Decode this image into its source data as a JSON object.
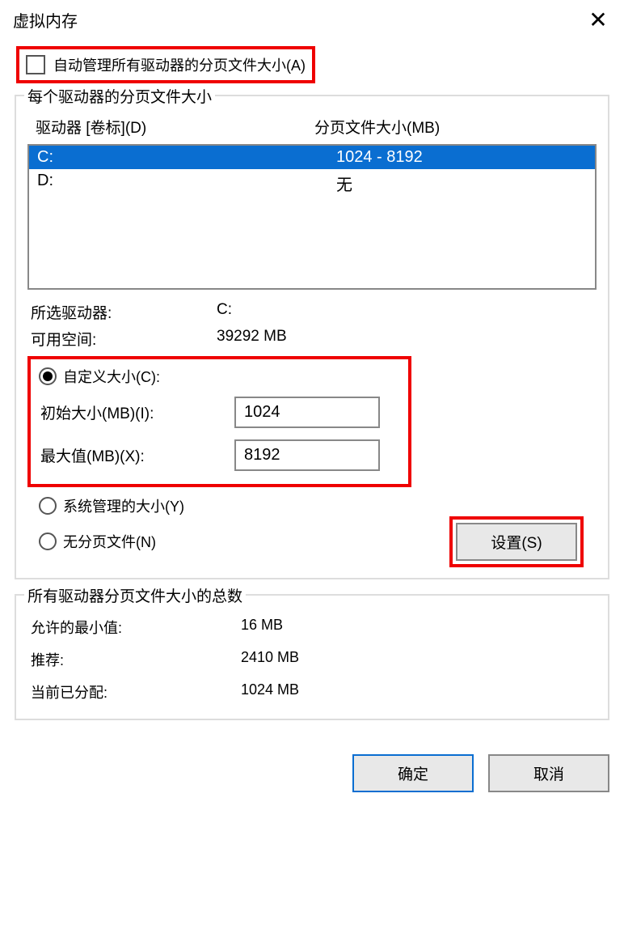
{
  "title": "虚拟内存",
  "auto_manage_label": "自动管理所有驱动器的分页文件大小(A)",
  "auto_manage_checked": false,
  "per_drive": {
    "legend": "每个驱动器的分页文件大小",
    "col_drive": "驱动器 [卷标](D)",
    "col_size": "分页文件大小(MB)",
    "rows": [
      {
        "drive": "C:",
        "size": "1024 - 8192",
        "selected": true
      },
      {
        "drive": "D:",
        "size": "无",
        "selected": false
      }
    ],
    "selected_drive_label": "所选驱动器:",
    "selected_drive_value": "C:",
    "free_space_label": "可用空间:",
    "free_space_value": "39292 MB",
    "custom": {
      "label": "自定义大小(C):",
      "initial_label": "初始大小(MB)(I):",
      "initial_value": "1024",
      "max_label": "最大值(MB)(X):",
      "max_value": "8192"
    },
    "system_managed_label": "系统管理的大小(Y)",
    "no_paging_label": "无分页文件(N)",
    "set_button": "设置(S)"
  },
  "all_totals": {
    "legend": "所有驱动器分页文件大小的总数",
    "min_label": "允许的最小值:",
    "min_value": "16 MB",
    "rec_label": "推荐:",
    "rec_value": "2410 MB",
    "cur_label": "当前已分配:",
    "cur_value": "1024 MB"
  },
  "footer": {
    "ok": "确定",
    "cancel": "取消"
  }
}
